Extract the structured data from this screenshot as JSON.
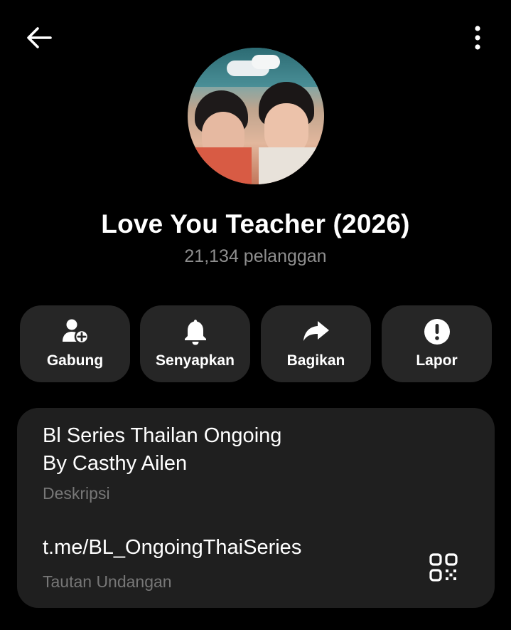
{
  "channel": {
    "title": "Love You Teacher (2026)",
    "subscribers": "21,134 pelanggan"
  },
  "actions": [
    {
      "label": "Gabung",
      "icon": "add-user-icon"
    },
    {
      "label": "Senyapkan",
      "icon": "bell-icon"
    },
    {
      "label": "Bagikan",
      "icon": "share-icon"
    },
    {
      "label": "Lapor",
      "icon": "report-icon"
    }
  ],
  "info": {
    "description_line1": "Bl Series Thailan Ongoing",
    "description_line2": "By Casthy Ailen",
    "description_label": "Deskripsi",
    "invite_link": "t.me/BL_OngoingThaiSeries",
    "invite_label": "Tautan Undangan"
  },
  "colors": {
    "background": "#000000",
    "button_bg": "#262626",
    "card_bg": "#1f1f1f",
    "muted_text": "#8e8e8e"
  }
}
